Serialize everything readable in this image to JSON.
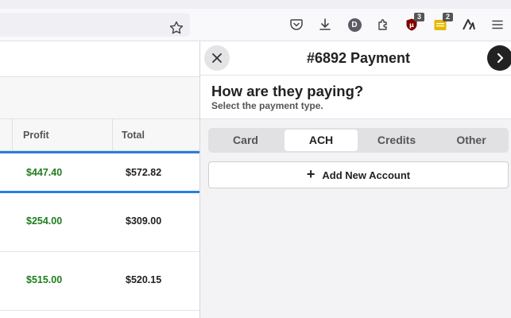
{
  "browser": {
    "toolbar_icons": [
      "pocket-icon",
      "download-icon",
      "profile-avatar",
      "extensions-icon",
      "ublock-icon",
      "extension-notes-icon",
      "extension-arc-icon",
      "menu-icon"
    ],
    "avatar_letter": "D",
    "ublock_badge": "3",
    "notes_badge": "2"
  },
  "table": {
    "headers": {
      "profit": "Profit",
      "total": "Total"
    },
    "rows": [
      {
        "profit": "$447.40",
        "total": "$572.82",
        "selected": true
      },
      {
        "profit": "$254.00",
        "total": "$309.00",
        "selected": false
      },
      {
        "profit": "$515.00",
        "total": "$520.15",
        "selected": false
      }
    ]
  },
  "panel": {
    "title": "#6892 Payment",
    "question": "How are they paying?",
    "subtitle": "Select the payment type.",
    "tabs": [
      {
        "label": "Card",
        "active": false
      },
      {
        "label": "ACH",
        "active": true
      },
      {
        "label": "Credits",
        "active": false
      },
      {
        "label": "Other",
        "active": false
      }
    ],
    "add_account_label": "Add New Account",
    "add_icon": "+"
  },
  "colors": {
    "profit": "#1e7d1e",
    "selection": "#2a7de1",
    "next_button": "#222222"
  }
}
